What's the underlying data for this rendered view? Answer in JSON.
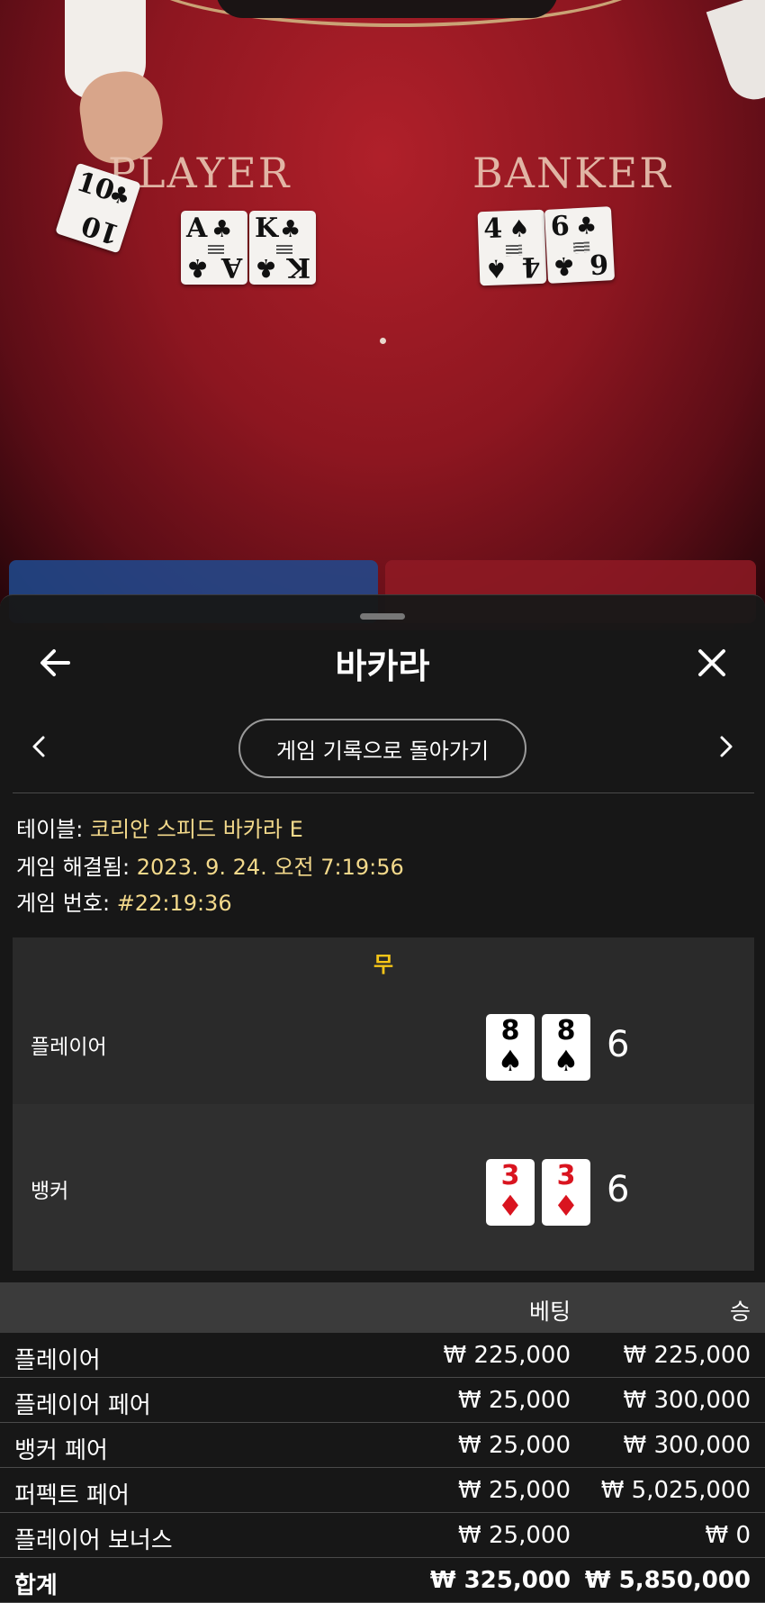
{
  "felt": {
    "player_label": "PLAYER",
    "banker_label": "BANKER",
    "player_cards": [
      {
        "rank": "A",
        "suit": "♣"
      },
      {
        "rank": "K",
        "suit": "♣"
      }
    ],
    "banker_cards": [
      {
        "rank": "4",
        "suit": "♠"
      },
      {
        "rank": "6",
        "suit": "♣"
      }
    ],
    "dealt_card": {
      "rank": "10",
      "suit": "♣"
    }
  },
  "panel": {
    "title": "바카라",
    "history_button": "게임 기록으로 돌아가기",
    "table_label": "테이블:",
    "table_value": "코리안 스피드 바카라 E",
    "resolved_label": "게임 해결됨:",
    "resolved_value": "2023. 9. 24. 오전 7:19:56",
    "round_label": "게임 번호:",
    "round_value": "#22:19:36"
  },
  "result": {
    "outcome": "무",
    "player_label": "플레이어",
    "player_cards": [
      {
        "rank": "8",
        "suit": "♠",
        "color": "black"
      },
      {
        "rank": "8",
        "suit": "♠",
        "color": "black"
      }
    ],
    "player_score": "6",
    "banker_label": "뱅커",
    "banker_cards": [
      {
        "rank": "3",
        "suit": "♦",
        "color": "red"
      },
      {
        "rank": "3",
        "suit": "♦",
        "color": "red"
      }
    ],
    "banker_score": "6"
  },
  "bets": {
    "header_bet": "베팅",
    "header_win": "승",
    "rows": [
      {
        "name": "플레이어",
        "bet": "₩ 225,000",
        "win": "₩ 225,000"
      },
      {
        "name": "플레이어 페어",
        "bet": "₩ 25,000",
        "win": "₩ 300,000"
      },
      {
        "name": "뱅커 페어",
        "bet": "₩ 25,000",
        "win": "₩ 300,000"
      },
      {
        "name": "퍼펙트 페어",
        "bet": "₩ 25,000",
        "win": "₩ 5,025,000"
      },
      {
        "name": "플레이어 보너스",
        "bet": "₩ 25,000",
        "win": "₩ 0"
      }
    ],
    "total": {
      "name": "합계",
      "bet": "₩ 325,000",
      "win": "₩ 5,850,000"
    }
  },
  "colors": {
    "accent_yellow": "#f5c518",
    "info_value": "#f3d98b",
    "felt_red": "#8d1620",
    "player_blue": "#1f4a8f",
    "banker_red": "#8f1a24"
  },
  "icons": {
    "back": "arrow-left-icon",
    "close": "close-icon",
    "prev": "chevron-left-icon",
    "next": "chevron-right-icon"
  }
}
